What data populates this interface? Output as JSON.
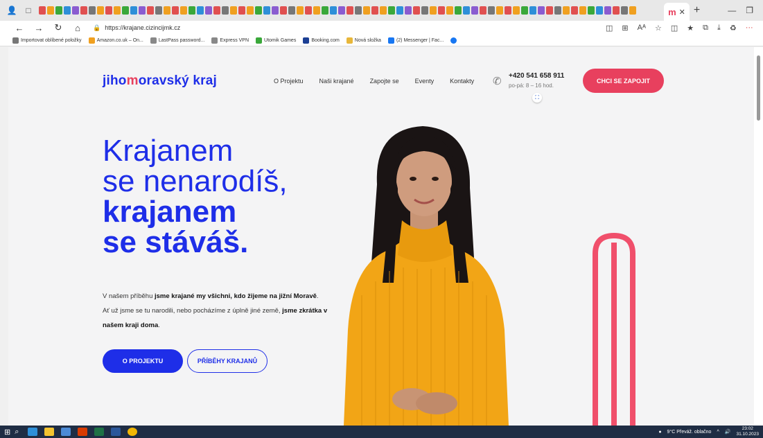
{
  "browser": {
    "active_tab_favicon": "m",
    "url": "https://krajane.cizincijmk.cz",
    "favorites": [
      {
        "label": "Importovat oblíbené položky",
        "icon": "import-icon",
        "color": "#777777"
      },
      {
        "label": "Amazon.co.uk – On...",
        "icon": "amazon-icon",
        "color": "#f0a020"
      },
      {
        "label": "LastPass password...",
        "icon": "page-icon",
        "color": "#888888"
      },
      {
        "label": "Express VPN",
        "icon": "page-icon",
        "color": "#888888"
      },
      {
        "label": "Utomik Games",
        "icon": "utomik-icon",
        "color": "#3aa83a"
      },
      {
        "label": "Booking.com",
        "icon": "booking-icon",
        "color": "#1c3f94"
      },
      {
        "label": "Nová složka",
        "icon": "folder-icon",
        "color": "#e8b73a"
      },
      {
        "label": "(2) Messenger | Fac...",
        "icon": "facebook-icon",
        "color": "#1877f2"
      }
    ]
  },
  "site": {
    "logo_part1": "jiho",
    "logo_m": "m",
    "logo_part2": "oravský kraj",
    "nav": [
      "O Projektu",
      "Naši krajané",
      "Zapojte se",
      "Eventy",
      "Kontakty"
    ],
    "phone": "+420 541 658 911",
    "hours": "po-pá: 8 – 16 hod.",
    "cta": "CHCI SE ZAPOJIT",
    "headline": {
      "line1": "Krajanem",
      "line2": "se nenarodíš,",
      "line3": "krajanem",
      "line4": "se stáváš."
    },
    "intro": {
      "p1_a": "V našem příběhu ",
      "p1_b": "jsme krajané my všichni, kdo žijeme na jižní Moravě",
      "p1_c": ".",
      "p2_a": "Ať už jsme se tu narodili, nebo pocházíme z úplně jiné země, ",
      "p2_b": "jsme zkrátka v našem kraji doma",
      "p2_c": "."
    },
    "btn_primary": "O PROJEKTU",
    "btn_outline": "PŘÍBĚHY KRAJANŮ"
  },
  "taskbar": {
    "weather": "9°C  Převáž. oblačno",
    "time": "23:02",
    "date": "31.10.2023"
  },
  "colors": {
    "brand_blue": "#1e2ee8",
    "brand_pink": "#e8405e",
    "sweater": "#f2a516",
    "hair": "#1a1414"
  }
}
